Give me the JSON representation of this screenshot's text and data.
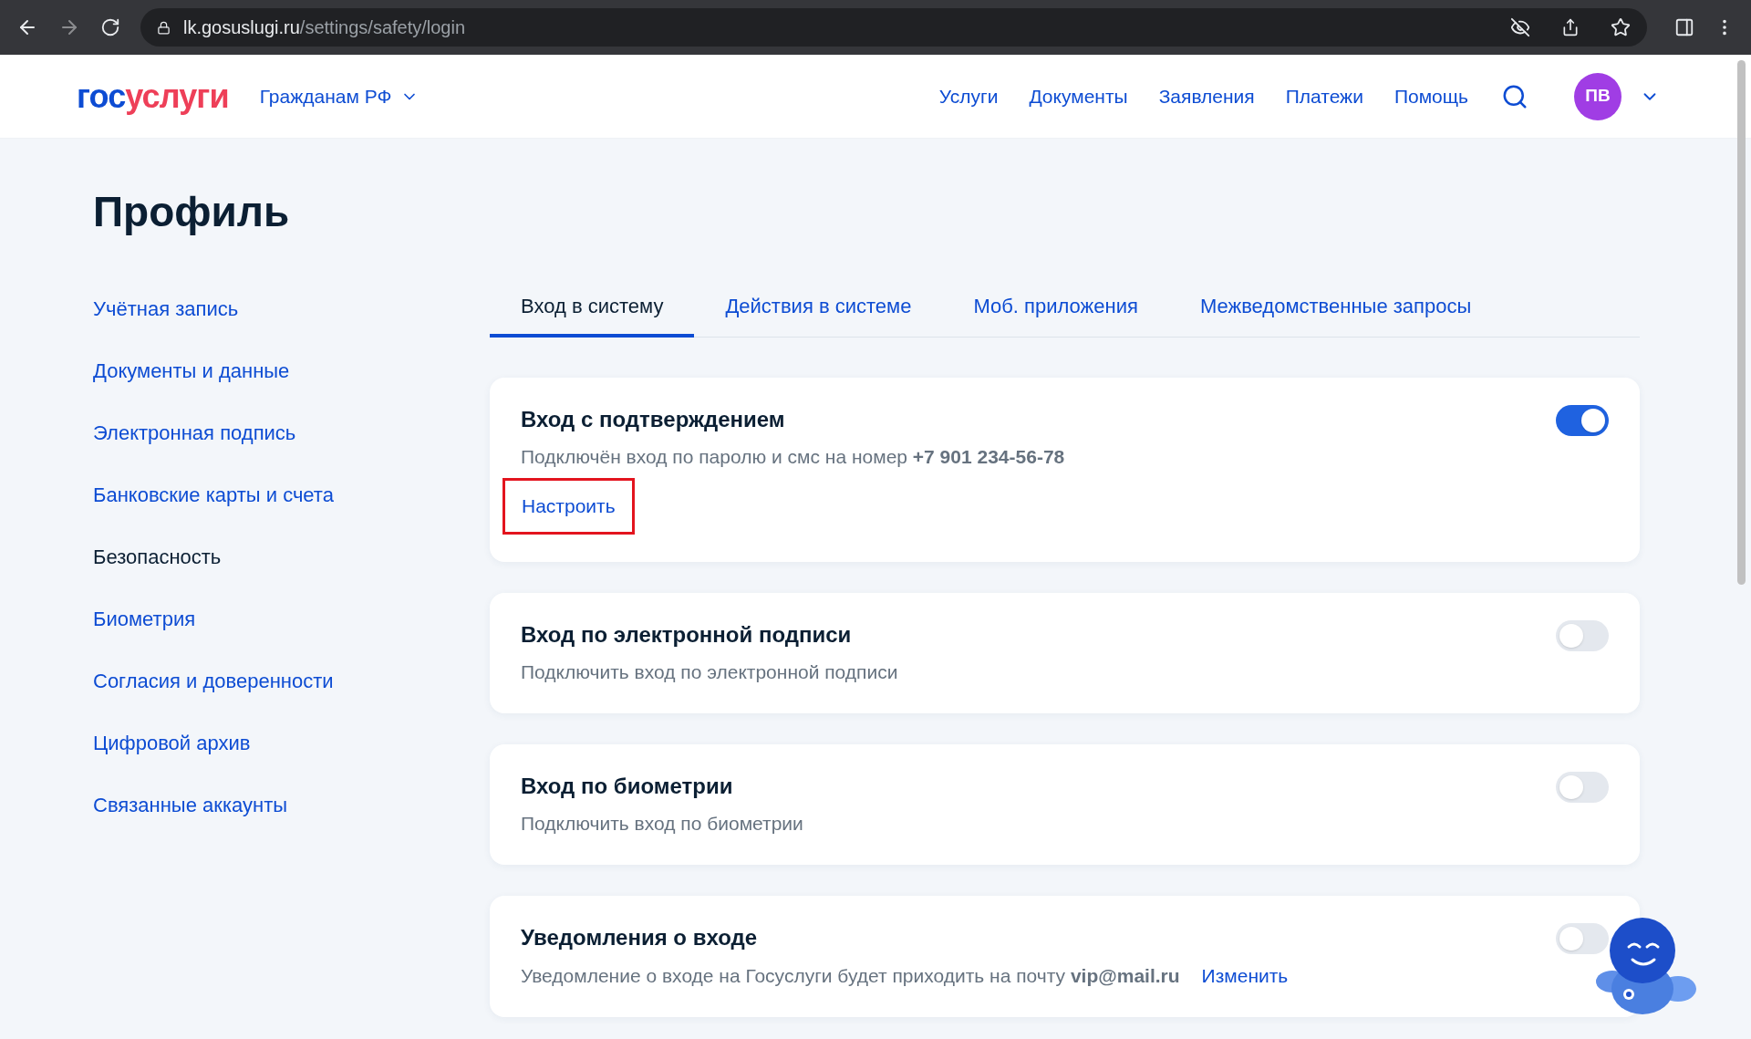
{
  "browser": {
    "url_host": "lk.gosuslugi.ru",
    "url_path": "/settings/safety/login"
  },
  "header": {
    "logo_first": "гос",
    "logo_second": "услуги",
    "region_menu": "Гражданам РФ",
    "nav": [
      "Услуги",
      "Документы",
      "Заявления",
      "Платежи",
      "Помощь"
    ],
    "avatar": "ПВ"
  },
  "page_title": "Профиль",
  "sidebar": {
    "items": [
      {
        "label": "Учётная запись",
        "selected": false
      },
      {
        "label": "Документы и данные",
        "selected": false
      },
      {
        "label": "Электронная подпись",
        "selected": false
      },
      {
        "label": "Банковские карты и счета",
        "selected": false
      },
      {
        "label": "Безопасность",
        "selected": true
      },
      {
        "label": "Биометрия",
        "selected": false
      },
      {
        "label": "Согласия и доверенности",
        "selected": false
      },
      {
        "label": "Цифровой архив",
        "selected": false
      },
      {
        "label": "Связанные аккаунты",
        "selected": false
      }
    ]
  },
  "tabs": [
    {
      "label": "Вход в систему",
      "selected": true
    },
    {
      "label": "Действия в системе",
      "selected": false
    },
    {
      "label": "Моб. приложения",
      "selected": false
    },
    {
      "label": "Межведомственные запросы",
      "selected": false
    }
  ],
  "cards": [
    {
      "title": "Вход с подтверждением",
      "description": "Подключён вход по паролю и смс на номер **+7 901 234-56-78**",
      "on": true,
      "action": {
        "label": "Настроить",
        "highlighted": true
      }
    },
    {
      "title": "Вход по электронной подписи",
      "description": "Подключить вход по электронной подписи",
      "on": false
    },
    {
      "title": "Вход по биометрии",
      "description": "Подключить вход по биометрии",
      "on": false
    },
    {
      "title": "Уведомления о входе",
      "description": "Уведомление о входе на Госуслуги будет приходить на почту **vip@mail.ru**",
      "on": false,
      "link": "Изменить"
    }
  ]
}
